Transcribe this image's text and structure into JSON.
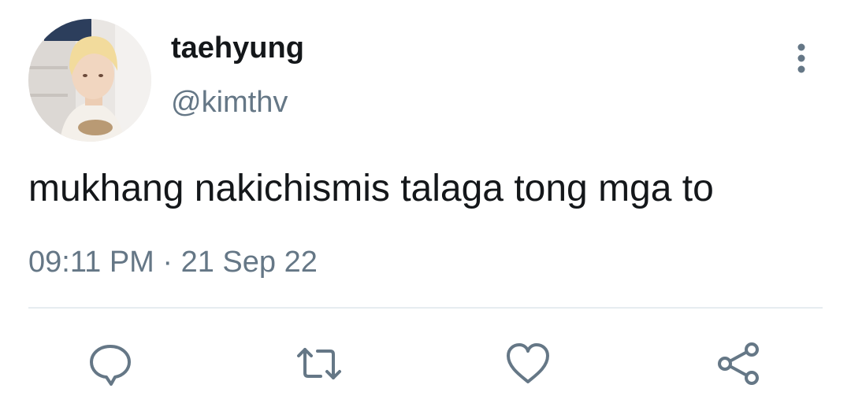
{
  "tweet": {
    "display_name": "taehyung",
    "handle": "@kimthv",
    "text": "mukhang nakichismis talaga tong mga to",
    "timestamp": "09:11 PM · 21 Sep 22"
  },
  "icons": {
    "more": "vertical-dots-icon",
    "reply": "speech-bubble-icon",
    "retweet": "retweet-arrows-icon",
    "like": "heart-icon",
    "share": "share-nodes-icon"
  },
  "colors": {
    "text_primary": "#14171a",
    "text_secondary": "#657786",
    "icon": "#657786",
    "divider": "#e6ecf0"
  }
}
